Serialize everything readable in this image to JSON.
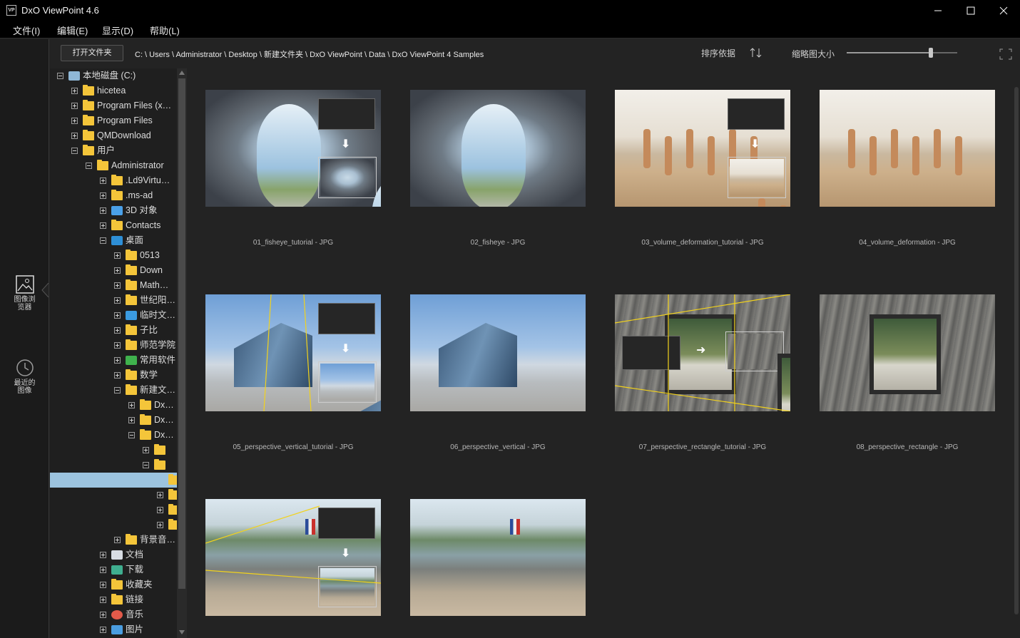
{
  "window": {
    "title": "DxO ViewPoint 4.6",
    "logo_text": "VP"
  },
  "menu": [
    "文件(I)",
    "编辑(E)",
    "显示(D)",
    "帮助(L)"
  ],
  "rail": {
    "browser_label": "图像浏览器",
    "recent_label": "最近的图像"
  },
  "toolbar": {
    "open_folder": "打开文件夹",
    "path": "C: \\ Users \\ Administrator \\ Desktop \\ 新建文件夹 \\ DxO ViewPoint \\ Data \\ DxO ViewPoint 4 Samples",
    "sort_label": "排序依据",
    "thumb_size_label": "缩略图大小",
    "thumb_size_level": 0.76
  },
  "tree": [
    {
      "label": "本地磁盘 (C:)",
      "level": 0,
      "exp": "minus",
      "icon": "drive-icon"
    },
    {
      "label": "hicetea",
      "level": 1,
      "exp": "plus",
      "icon": "folder-icon"
    },
    {
      "label": "Program Files (x…",
      "level": 1,
      "exp": "plus",
      "icon": "folder-icon"
    },
    {
      "label": "Program Files",
      "level": 1,
      "exp": "plus",
      "icon": "folder-icon"
    },
    {
      "label": "QMDownload",
      "level": 1,
      "exp": "plus",
      "icon": "folder-icon"
    },
    {
      "label": "用户",
      "level": 1,
      "exp": "minus",
      "icon": "folder-icon"
    },
    {
      "label": "Administrator",
      "level": 2,
      "exp": "minus",
      "icon": "folder-icon"
    },
    {
      "label": ".Ld9Virtu…",
      "level": 3,
      "exp": "plus",
      "icon": "folder-icon"
    },
    {
      "label": ".ms-ad",
      "level": 3,
      "exp": "plus",
      "icon": "folder-icon"
    },
    {
      "label": "3D 对象",
      "level": 3,
      "exp": "plus",
      "icon": "cube-icon"
    },
    {
      "label": "Contacts",
      "level": 3,
      "exp": "plus",
      "icon": "folder-icon"
    },
    {
      "label": "桌面",
      "level": 3,
      "exp": "minus",
      "icon": "desktop-icon"
    },
    {
      "label": "0513",
      "level": 4,
      "exp": "plus",
      "icon": "folder-icon"
    },
    {
      "label": "Down",
      "level": 4,
      "exp": "plus",
      "icon": "folder-icon"
    },
    {
      "label": "Math…",
      "level": 4,
      "exp": "plus",
      "icon": "folder-icon"
    },
    {
      "label": "世纪阳…",
      "level": 4,
      "exp": "plus",
      "icon": "folder-icon"
    },
    {
      "label": "临时文…",
      "level": 4,
      "exp": "plus",
      "icon": "monitor-icon"
    },
    {
      "label": "子比",
      "level": 4,
      "exp": "plus",
      "icon": "folder-icon"
    },
    {
      "label": "师范学院",
      "level": 4,
      "exp": "plus",
      "icon": "folder-icon"
    },
    {
      "label": "常用软件",
      "level": 4,
      "exp": "plus",
      "icon": "tree-icon"
    },
    {
      "label": "数学",
      "level": 4,
      "exp": "plus",
      "icon": "folder-icon"
    },
    {
      "label": "新建文…",
      "level": 4,
      "exp": "minus",
      "icon": "folder-icon"
    },
    {
      "label": "Dx…",
      "level": 5,
      "exp": "plus",
      "icon": "folder-icon"
    },
    {
      "label": "Dx…",
      "level": 5,
      "exp": "plus",
      "icon": "folder-icon"
    },
    {
      "label": "Dx…",
      "level": 5,
      "exp": "minus",
      "icon": "folder-icon"
    },
    {
      "label": "",
      "level": 6,
      "exp": "plus",
      "icon": "folder-icon"
    },
    {
      "label": "",
      "level": 6,
      "exp": "minus",
      "icon": "folder-icon"
    },
    {
      "label": "",
      "level": 7,
      "exp": "none",
      "icon": "folder-icon",
      "selected": true
    },
    {
      "label": "",
      "level": 7,
      "exp": "plus",
      "icon": "folder-icon"
    },
    {
      "label": "",
      "level": 7,
      "exp": "plus",
      "icon": "folder-icon"
    },
    {
      "label": "",
      "level": 7,
      "exp": "plus",
      "icon": "folder-icon"
    },
    {
      "label": "背景音…",
      "level": 4,
      "exp": "plus",
      "icon": "folder-icon"
    },
    {
      "label": "文档",
      "level": 3,
      "exp": "plus",
      "icon": "document-icon"
    },
    {
      "label": "下载",
      "level": 3,
      "exp": "plus",
      "icon": "download-icon"
    },
    {
      "label": "收藏夹",
      "level": 3,
      "exp": "plus",
      "icon": "folder-icon"
    },
    {
      "label": "链接",
      "level": 3,
      "exp": "plus",
      "icon": "folder-icon"
    },
    {
      "label": "音乐",
      "level": 3,
      "exp": "plus",
      "icon": "music-icon"
    },
    {
      "label": "图片",
      "level": 3,
      "exp": "plus",
      "icon": "picture-icon"
    }
  ],
  "images": [
    {
      "caption": "01_fisheye_tutorial - JPG",
      "kind": "fisheye",
      "tutorial": true
    },
    {
      "caption": "02_fisheye - JPG",
      "kind": "fisheye",
      "tutorial": false
    },
    {
      "caption": "03_volume_deformation_tutorial - JPG",
      "kind": "beach",
      "tutorial": true
    },
    {
      "caption": "04_volume_deformation - JPG",
      "kind": "beach",
      "tutorial": false
    },
    {
      "caption": "05_perspective_vertical_tutorial - JPG",
      "kind": "building",
      "tutorial": true
    },
    {
      "caption": "06_perspective_vertical - JPG",
      "kind": "building",
      "tutorial": false
    },
    {
      "caption": "07_perspective_rectangle_tutorial - JPG",
      "kind": "wall",
      "tutorial": true
    },
    {
      "caption": "08_perspective_rectangle - JPG",
      "kind": "wall",
      "tutorial": false
    },
    {
      "caption": "",
      "kind": "river",
      "tutorial": true
    },
    {
      "caption": "",
      "kind": "river",
      "tutorial": false
    }
  ]
}
